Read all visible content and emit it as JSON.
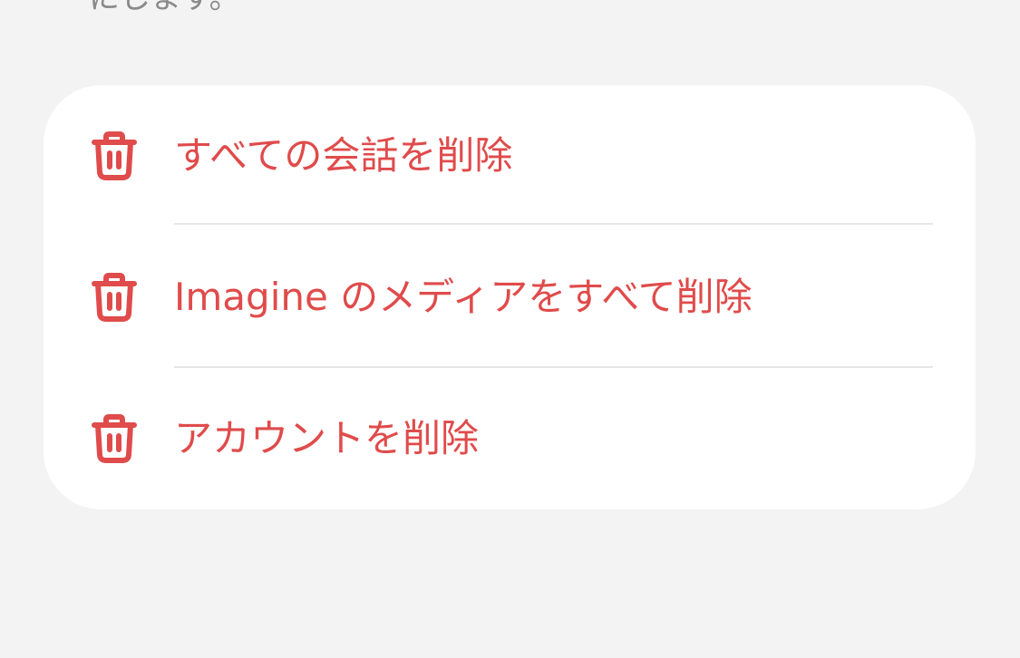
{
  "header": {
    "partial_text": "にします。"
  },
  "danger_zone": {
    "accent_color": "#e04b4b",
    "items": [
      {
        "label": "すべての会話を削除",
        "icon": "trash-icon"
      },
      {
        "label": "Imagine のメディアをすべて削除",
        "icon": "trash-icon"
      },
      {
        "label": "アカウントを削除",
        "icon": "trash-icon"
      }
    ]
  }
}
